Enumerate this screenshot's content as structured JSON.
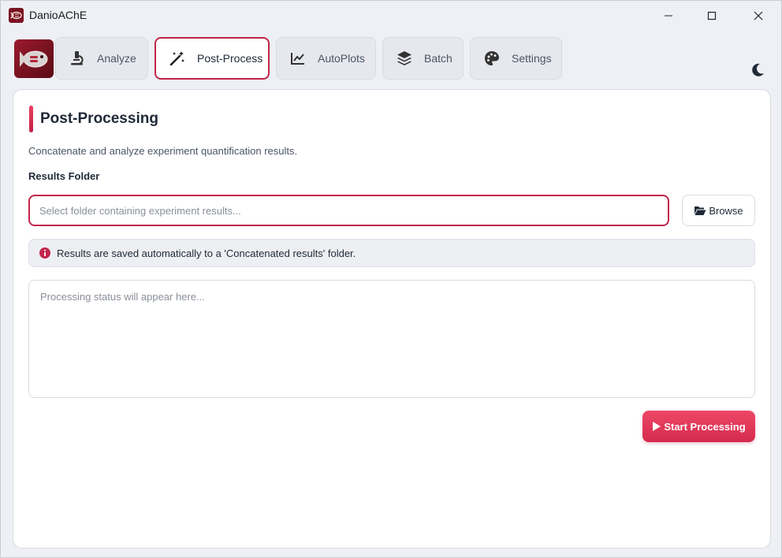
{
  "window": {
    "title": "DanioAChE"
  },
  "tabs": [
    {
      "label": "Analyze",
      "icon": "microscope-icon",
      "active": false
    },
    {
      "label": "Post-Process",
      "icon": "magic-wand-icon",
      "active": true
    },
    {
      "label": "AutoPlots",
      "icon": "line-chart-icon",
      "active": false
    },
    {
      "label": "Batch",
      "icon": "layers-icon",
      "active": false
    },
    {
      "label": "Settings",
      "icon": "palette-icon",
      "active": false
    }
  ],
  "main": {
    "title": "Post-Processing",
    "description": "Concatenate and analyze experiment quantification results.",
    "folder_label": "Results Folder",
    "folder_placeholder": "Select folder containing experiment results...",
    "folder_value": "",
    "browse_label": "Browse",
    "info_text": "Results are saved automatically to a 'Concatenated results' folder.",
    "status_placeholder": "Processing status will appear here...",
    "start_label": "Start Processing"
  },
  "colors": {
    "accent": "#c2254a",
    "button_gradient_top": "#ee4866",
    "button_gradient_bottom": "#d42a4e"
  }
}
